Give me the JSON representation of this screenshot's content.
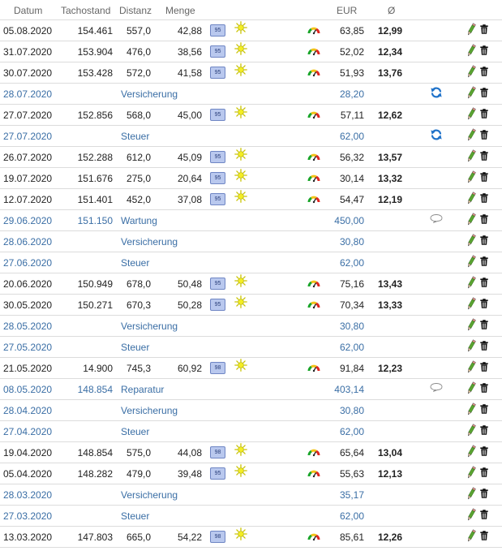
{
  "header": {
    "date": "Datum",
    "tacho": "Tachostand",
    "distance": "Distanz",
    "amount": "Menge",
    "currency": "EUR",
    "average": "Ø"
  },
  "rows": [
    {
      "type": "fuel",
      "date": "05.08.2020",
      "tacho": "154.461",
      "distance": "557,0",
      "amount": "42,88",
      "fuel": "95",
      "eur": "63,85",
      "avg": "12,99"
    },
    {
      "type": "fuel",
      "date": "31.07.2020",
      "tacho": "153.904",
      "distance": "476,0",
      "amount": "38,56",
      "fuel": "95",
      "eur": "52,02",
      "avg": "12,34"
    },
    {
      "type": "fuel",
      "date": "30.07.2020",
      "tacho": "153.428",
      "distance": "572,0",
      "amount": "41,58",
      "fuel": "95",
      "eur": "51,93",
      "avg": "13,76"
    },
    {
      "type": "cost",
      "date": "28.07.2020",
      "label": "Versicherung",
      "eur": "28,20",
      "extra": "refresh"
    },
    {
      "type": "fuel",
      "date": "27.07.2020",
      "tacho": "152.856",
      "distance": "568,0",
      "amount": "45,00",
      "fuel": "95",
      "eur": "57,11",
      "avg": "12,62"
    },
    {
      "type": "cost",
      "date": "27.07.2020",
      "label": "Steuer",
      "eur": "62,00",
      "extra": "refresh"
    },
    {
      "type": "fuel",
      "date": "26.07.2020",
      "tacho": "152.288",
      "distance": "612,0",
      "amount": "45,09",
      "fuel": "95",
      "eur": "56,32",
      "avg": "13,57"
    },
    {
      "type": "fuel",
      "date": "19.07.2020",
      "tacho": "151.676",
      "distance": "275,0",
      "amount": "20,64",
      "fuel": "95",
      "eur": "30,14",
      "avg": "13,32"
    },
    {
      "type": "fuel",
      "date": "12.07.2020",
      "tacho": "151.401",
      "distance": "452,0",
      "amount": "37,08",
      "fuel": "95",
      "eur": "54,47",
      "avg": "12,19"
    },
    {
      "type": "cost",
      "date": "29.06.2020",
      "tacho": "151.150",
      "label": "Wartung",
      "eur": "450,00",
      "extra": "comment"
    },
    {
      "type": "cost",
      "date": "28.06.2020",
      "label": "Versicherung",
      "eur": "30,80"
    },
    {
      "type": "cost",
      "date": "27.06.2020",
      "label": "Steuer",
      "eur": "62,00"
    },
    {
      "type": "fuel",
      "date": "20.06.2020",
      "tacho": "150.949",
      "distance": "678,0",
      "amount": "50,48",
      "fuel": "95",
      "eur": "75,16",
      "avg": "13,43"
    },
    {
      "type": "fuel",
      "date": "30.05.2020",
      "tacho": "150.271",
      "distance": "670,3",
      "amount": "50,28",
      "fuel": "95",
      "eur": "70,34",
      "avg": "13,33"
    },
    {
      "type": "cost",
      "date": "28.05.2020",
      "label": "Versicherung",
      "eur": "30,80"
    },
    {
      "type": "cost",
      "date": "27.05.2020",
      "label": "Steuer",
      "eur": "62,00"
    },
    {
      "type": "fuel",
      "date": "21.05.2020",
      "tacho": "14.900",
      "distance": "745,3",
      "amount": "60,92",
      "fuel": "98",
      "eur": "91,84",
      "avg": "12,23"
    },
    {
      "type": "cost",
      "date": "08.05.2020",
      "tacho": "148.854",
      "label": "Reparatur",
      "eur": "403,14",
      "extra": "comment"
    },
    {
      "type": "cost",
      "date": "28.04.2020",
      "label": "Versicherung",
      "eur": "30,80"
    },
    {
      "type": "cost",
      "date": "27.04.2020",
      "label": "Steuer",
      "eur": "62,00"
    },
    {
      "type": "fuel",
      "date": "19.04.2020",
      "tacho": "148.854",
      "distance": "575,0",
      "amount": "44,08",
      "fuel": "98",
      "eur": "65,64",
      "avg": "13,04"
    },
    {
      "type": "fuel",
      "date": "05.04.2020",
      "tacho": "148.282",
      "distance": "479,0",
      "amount": "39,48",
      "fuel": "95",
      "eur": "55,63",
      "avg": "12,13"
    },
    {
      "type": "cost",
      "date": "28.03.2020",
      "label": "Versicherung",
      "eur": "35,17"
    },
    {
      "type": "cost",
      "date": "27.03.2020",
      "label": "Steuer",
      "eur": "62,00"
    },
    {
      "type": "fuel",
      "date": "13.03.2020",
      "tacho": "147.803",
      "distance": "665,0",
      "amount": "54,22",
      "fuel": "98",
      "eur": "85,61",
      "avg": "12,26"
    }
  ],
  "icons": {
    "fuel_type": "fuel-grade-badge",
    "season": "sun-icon",
    "efficiency": "speedometer-icon",
    "recurring": "refresh-icon",
    "note": "comment-icon",
    "edit": "pencil-icon",
    "delete": "trash-icon"
  }
}
